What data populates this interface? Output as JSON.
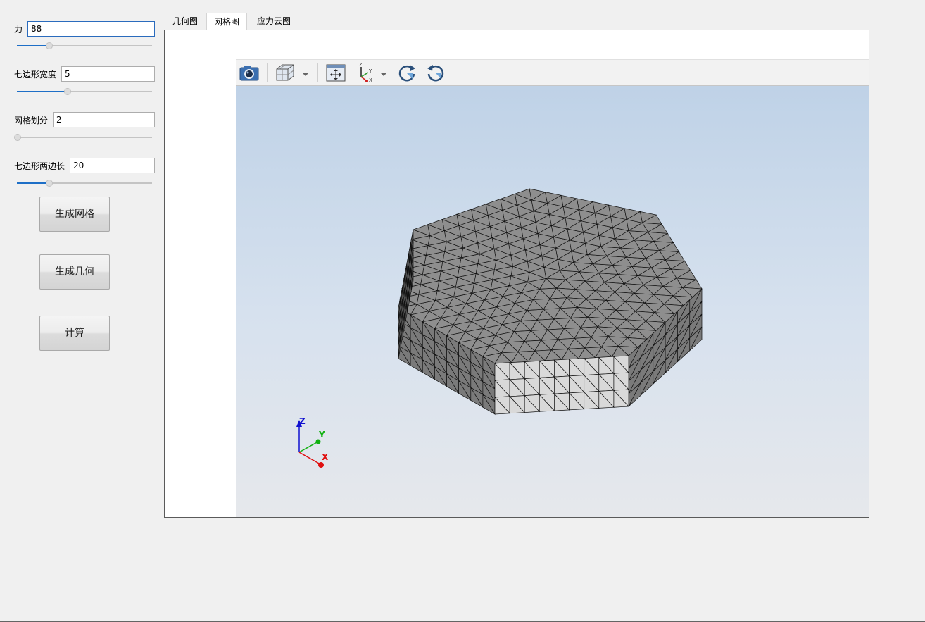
{
  "left_panel": {
    "fields": [
      {
        "label": "力",
        "value": "88",
        "slider_fraction": 0.24
      },
      {
        "label": "七边形宽度",
        "value": "5",
        "slider_fraction": 0.375
      },
      {
        "label": "网格划分",
        "value": "2",
        "slider_fraction": 0.0
      },
      {
        "label": "七边形两边长",
        "value": "20",
        "slider_fraction": 0.24
      }
    ],
    "buttons": {
      "generate_mesh": "生成网格",
      "generate_geometry": "生成几何",
      "compute": "计算"
    }
  },
  "tabs": [
    {
      "label": "几何图",
      "active": false
    },
    {
      "label": "网格图",
      "active": true
    },
    {
      "label": "应力云图",
      "active": false
    }
  ],
  "viewer": {
    "toolbar": [
      "camera-icon",
      "view-cube-icon",
      "fit-view-icon",
      "axes-orientation-icon",
      "rotate-clockwise-icon",
      "rotate-counterclockwise-icon"
    ],
    "axis_triad": {
      "z": "Z",
      "y": "Y",
      "x": "X"
    },
    "colors": {
      "x_axis": "#e01010",
      "y_axis": "#10b010",
      "z_axis": "#1010d0",
      "mesh_top": "#8e8e8e",
      "mesh_side": "#7a7a7a",
      "mesh_front": "#d9d9d9"
    }
  }
}
